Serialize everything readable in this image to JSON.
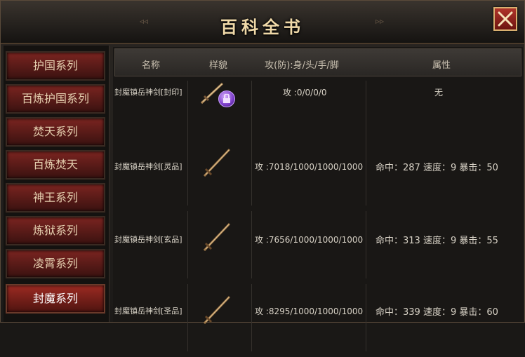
{
  "window": {
    "title": "百科全书"
  },
  "sidebar": {
    "items": [
      {
        "label": "护国系列"
      },
      {
        "label": "百炼护国系列"
      },
      {
        "label": "焚天系列"
      },
      {
        "label": "百炼焚天"
      },
      {
        "label": "神王系列"
      },
      {
        "label": "炼狱系列"
      },
      {
        "label": "凌霄系列"
      },
      {
        "label": "封魔系列"
      }
    ],
    "selected": "封魔系列"
  },
  "table": {
    "headers": [
      "名称",
      "样貌",
      "攻(防):身/头/手/脚",
      "属性"
    ],
    "rows": [
      {
        "name": "封魔镇岳神剑[封印]",
        "stats": "攻 :0/0/0/0",
        "attrs": "无"
      },
      {
        "name": "封魔镇岳神剑[灵品]",
        "stats": "攻 :7018/1000/1000/1000",
        "attrs": "命中：287 速度：9 暴击：50"
      },
      {
        "name": "封魔镇岳神剑[玄品]",
        "stats": "攻 :7656/1000/1000/1000",
        "attrs": "命中：313 速度：9 暴击：55"
      },
      {
        "name": "封魔镇岳神剑[圣品]",
        "stats": "攻 :8295/1000/1000/1000",
        "attrs": "命中：339 速度：9 暴击：60"
      }
    ]
  },
  "colors": {
    "accent": "#f0d9a8",
    "tab_red": "#7a2420",
    "seal_purple": "#7a3cc8"
  },
  "icons": {
    "close": "close-icon",
    "item": "sword-icon",
    "seal": "seal-icon"
  }
}
